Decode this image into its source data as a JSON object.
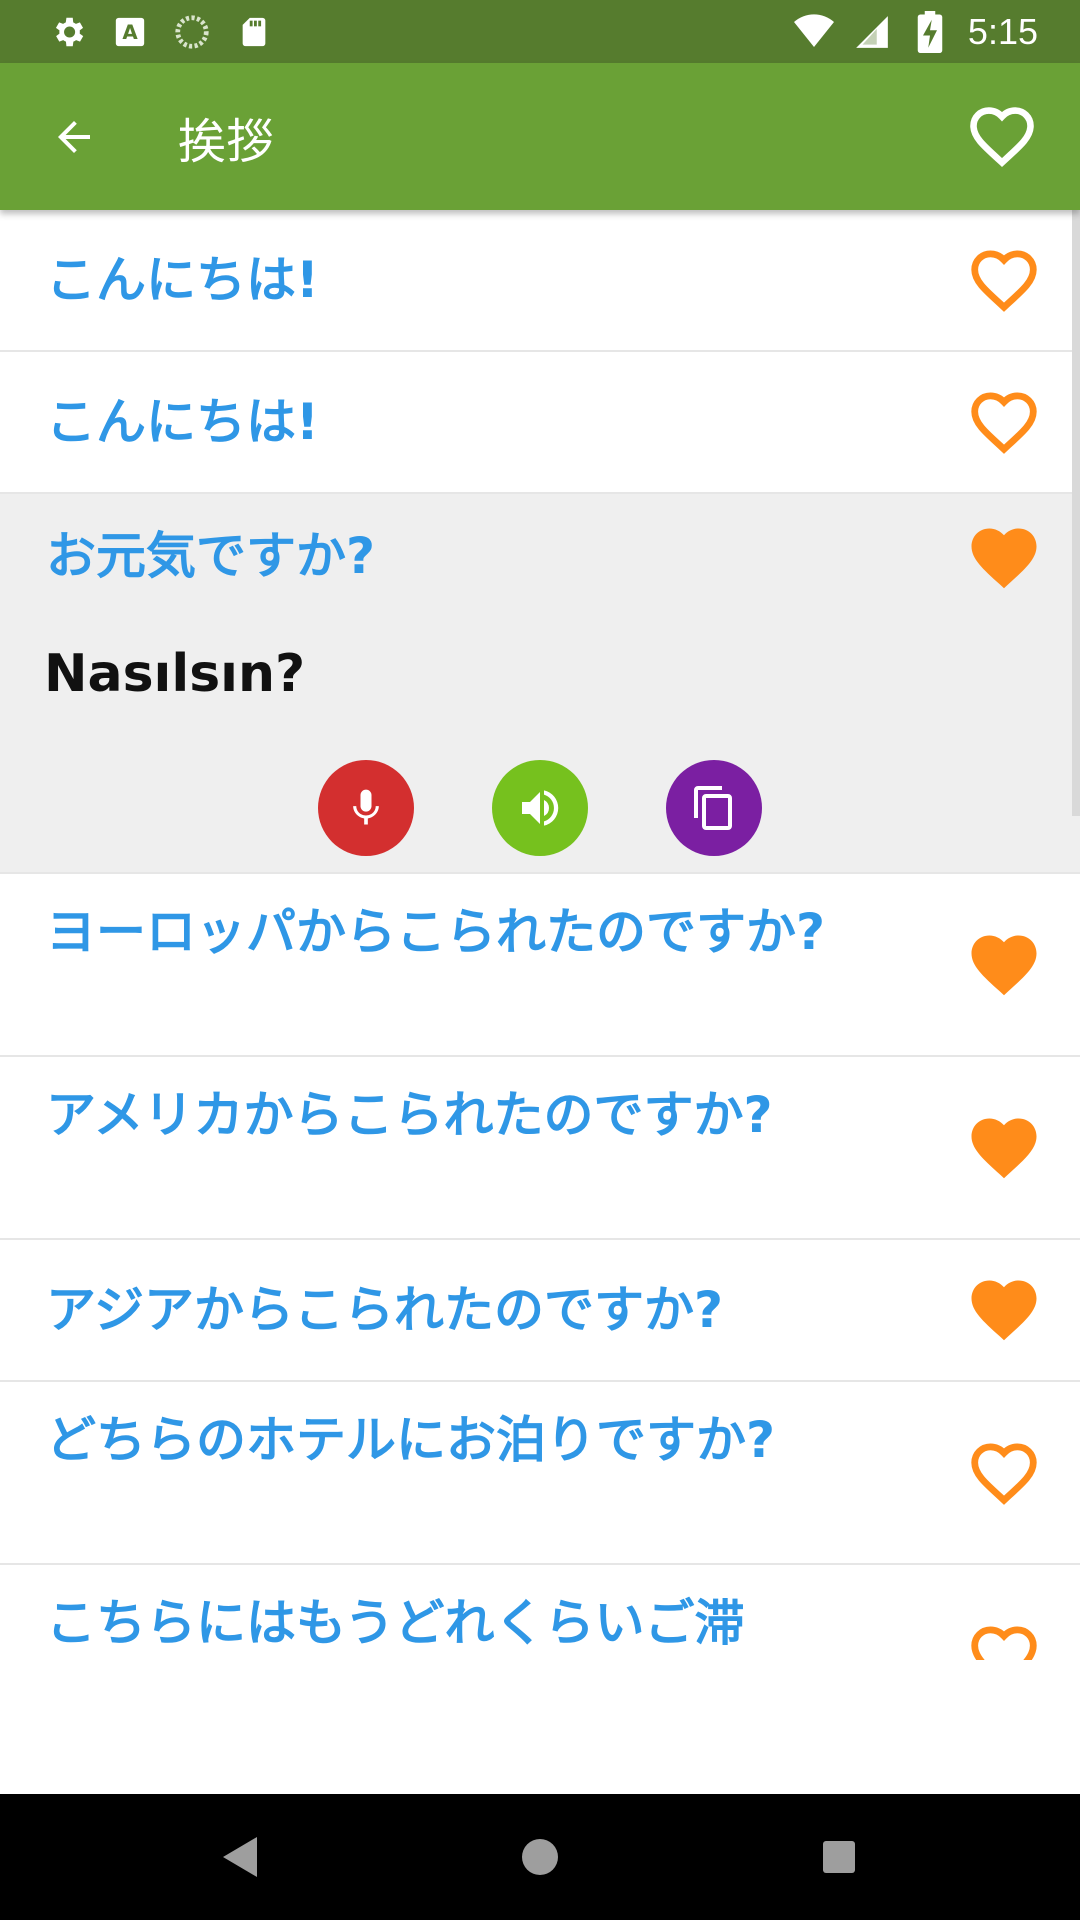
{
  "status_bar": {
    "time": "5:15",
    "icons": [
      "settings-icon",
      "keyboard-a-icon",
      "sync-circle-icon",
      "sd-card-icon",
      "wifi-icon",
      "signal-icon",
      "battery-charging-icon"
    ]
  },
  "app_bar": {
    "title": "挨拶",
    "back_icon": "arrow-back-icon",
    "favorite_icon": "heart-outline-icon"
  },
  "phrases": [
    {
      "text": "こんにちは!",
      "favorited": false
    },
    {
      "text": "こんにちは!",
      "favorited": false
    },
    {
      "text": "お元気ですか?",
      "favorited": true,
      "expanded": true,
      "translation": "Nasılsın?"
    },
    {
      "text": "ヨーロッパからこられたのですか?",
      "favorited": true
    },
    {
      "text": "アメリカからこられたのですか?",
      "favorited": true
    },
    {
      "text": "アジアからこられたのですか?",
      "favorited": true
    },
    {
      "text": "どちらのホテルにお泊りですか?",
      "favorited": false
    },
    {
      "text": "こちらにはもうどれくらいご滞",
      "favorited": false
    }
  ],
  "actions": {
    "record": "mic-icon",
    "play": "speaker-icon",
    "copy": "copy-icon"
  },
  "colors": {
    "status_bar": "#567c2e",
    "app_bar": "#6aa136",
    "phrase_text": "#2f97e6",
    "heart": "#ff8c1a",
    "mic_button": "#d32f2f",
    "speak_button": "#76c11e",
    "copy_button": "#7b1fa2"
  },
  "nav_bar": {
    "back": "nav-back-icon",
    "home": "nav-home-icon",
    "recents": "nav-recents-icon"
  }
}
